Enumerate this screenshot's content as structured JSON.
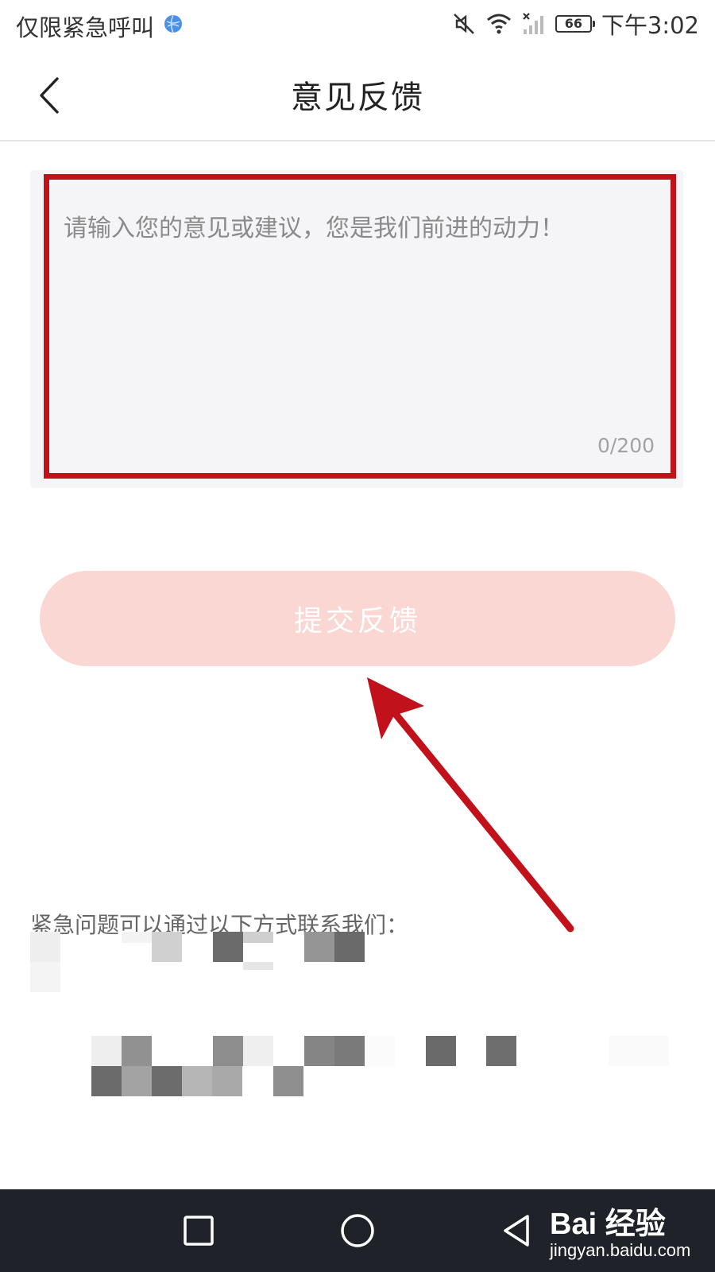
{
  "status_bar": {
    "carrier": "仅限紧急呼叫",
    "battery": "66",
    "time": "下午3:02"
  },
  "header": {
    "title": "意见反馈"
  },
  "feedback": {
    "placeholder": "请输入您的意见或建议，您是我们前进的动力！",
    "counter": "0/200"
  },
  "submit_label": "提交反馈",
  "contact": {
    "title": "紧急问题可以通过以下方式联系我们："
  },
  "watermark": {
    "logo": "Bai 经验",
    "url": "jingyan.baidu.com"
  },
  "colors": {
    "annotation_red": "#c1121b",
    "submit_bg": "#fad7d2",
    "nav_bg": "#1f2229"
  }
}
